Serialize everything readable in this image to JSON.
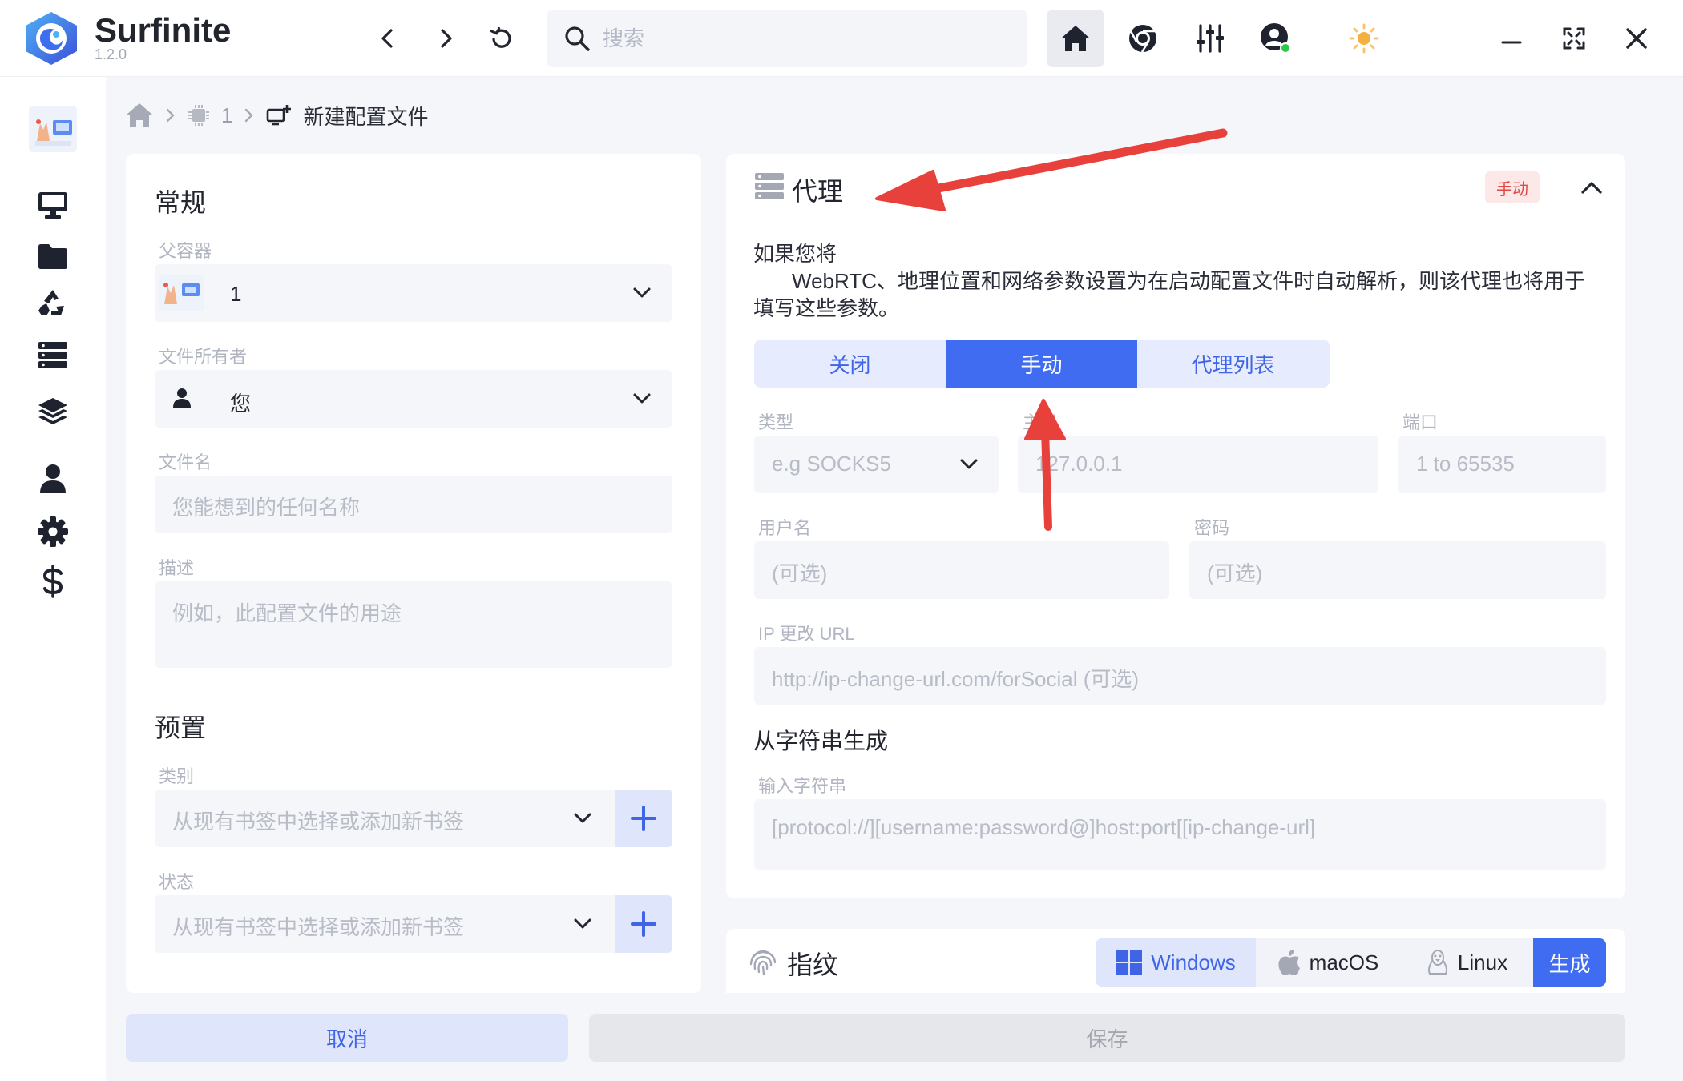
{
  "app": {
    "name": "Surfinite",
    "version": "1.2.0"
  },
  "topbar": {
    "search_placeholder": "搜索",
    "icons": [
      "back-icon",
      "forward-icon",
      "refresh-icon",
      "search-icon",
      "home-icon",
      "chrome-icon",
      "sliders-icon",
      "user-status-icon",
      "sun-icon",
      "minimize-icon",
      "maximize-icon",
      "close-icon"
    ]
  },
  "sidebar": {
    "icons": [
      "monitor-icon",
      "folder-icon",
      "recycle-icon",
      "server-icon",
      "layers-icon",
      "user-icon",
      "gear-icon",
      "dollar-icon"
    ]
  },
  "breadcrumb": {
    "item1": "1",
    "current": "新建配置文件"
  },
  "general": {
    "title": "常规",
    "parent_label": "父容器",
    "parent_value": "1",
    "owner_label": "文件所有者",
    "owner_value": "您",
    "filename_label": "文件名",
    "filename_placeholder": "您能想到的任何名称",
    "desc_label": "描述",
    "desc_placeholder": "例如，此配置文件的用途"
  },
  "preset": {
    "title": "预置",
    "category_label": "类别",
    "category_placeholder": "从现有书签中选择或添加新书签",
    "status_label": "状态",
    "status_placeholder": "从现有书签中选择或添加新书签"
  },
  "proxy": {
    "title": "代理",
    "badge": "手动",
    "desc_line1": "如果您将",
    "desc_line2": "WebRTC、地理位置和网络参数设置为在启动配置文件时自动解析，则该代理也将用于填写这些参数。",
    "modes": [
      "关闭",
      "手动",
      "代理列表"
    ],
    "active_mode": "手动",
    "type_label": "类型",
    "type_placeholder": "e.g SOCKS5",
    "host_label": "主机",
    "host_placeholder": "127.0.0.1",
    "port_label": "端口",
    "port_placeholder": "1 to 65535",
    "user_label": "用户名",
    "user_placeholder": "(可选)",
    "pass_label": "密码",
    "pass_placeholder": "(可选)",
    "ipurl_label": "IP 更改 URL",
    "ipurl_placeholder": "http://ip-change-url.com/forSocial (可选)",
    "fromstring_title": "从字符串生成",
    "input_label": "输入字符串",
    "input_placeholder": "[protocol://][username:password@]host:port[[ip-change-url]"
  },
  "fingerprint": {
    "title": "指纹",
    "os_options": [
      "Windows",
      "macOS",
      "Linux"
    ],
    "selected_os": "Windows",
    "generate": "生成"
  },
  "footer": {
    "cancel": "取消",
    "save": "保存"
  },
  "colors": {
    "accent": "#3f6cf0",
    "annotation_arrow": "#e8413c",
    "badge_red": "#e14646"
  }
}
